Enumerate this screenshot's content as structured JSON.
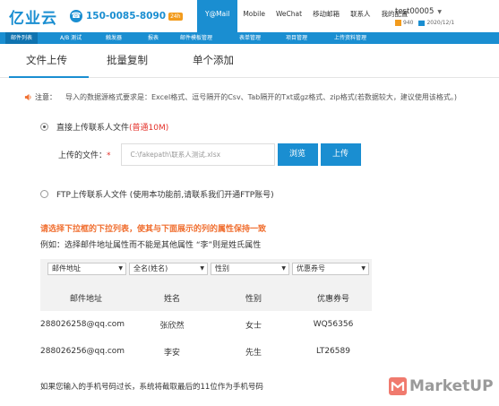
{
  "header": {
    "logo": "亿业云",
    "hotline_number": "150-0085-8090",
    "hotline_badge": "24h",
    "nav": [
      "Y@Mail",
      "Mobile",
      "WeChat",
      "移动邮箱",
      "联系人",
      "我的配置"
    ],
    "user": {
      "name": "test00005",
      "points": "940",
      "date": "2020/12/1"
    }
  },
  "subnav": [
    "邮件列表",
    "A/B 测试",
    "触发器",
    "报表",
    "邮件模板管理",
    "表单管理",
    "项目管理",
    "上传资料管理"
  ],
  "tabs": [
    "文件上传",
    "批量复制",
    "单个添加"
  ],
  "notice": {
    "label": "注意：",
    "text": "导入的数据源格式要求是：Excel格式、逗号隔开的Csv、Tab隔开的Txt或gz格式、zip格式(若数据较大，建议使用该格式。)"
  },
  "option_direct": {
    "label": "直接上传联系人文件",
    "hint": "(普通10M)"
  },
  "file_upload": {
    "label": "上传的文件：",
    "required": "*",
    "value": "C:\\fakepath\\联系人测试.xlsx",
    "browse_label": "浏览",
    "upload_label": "上传"
  },
  "option_ftp": {
    "label": "FTP上传联系人文件 (使用本功能前,请联系我们开通FTP账号)"
  },
  "instruction": "请选择下拉框的下拉列表，使其与下面展示的列的属性保持一致",
  "example": "例如：选择邮件地址属性而不能是其他属性 “李”则是姓氏属性",
  "mapping": {
    "selects": [
      "邮件地址",
      "全名(姓名)",
      "性别",
      "优惠券号"
    ],
    "headers": [
      "邮件地址",
      "姓名",
      "性别",
      "优惠券号"
    ],
    "rows": [
      [
        "288026258@qq.com",
        "张欣然",
        "女士",
        "WQ56356"
      ],
      [
        "288026256@qq.com",
        "李安",
        "先生",
        "LT26589"
      ]
    ]
  },
  "footer_note": "如果您输入的手机号码过长，系统将截取最后的11位作为手机号码",
  "watermark": "MarketUP",
  "colors": {
    "brand_blue": "#1a8ed1",
    "orange": "#f06e2f",
    "red": "#e4322b"
  }
}
